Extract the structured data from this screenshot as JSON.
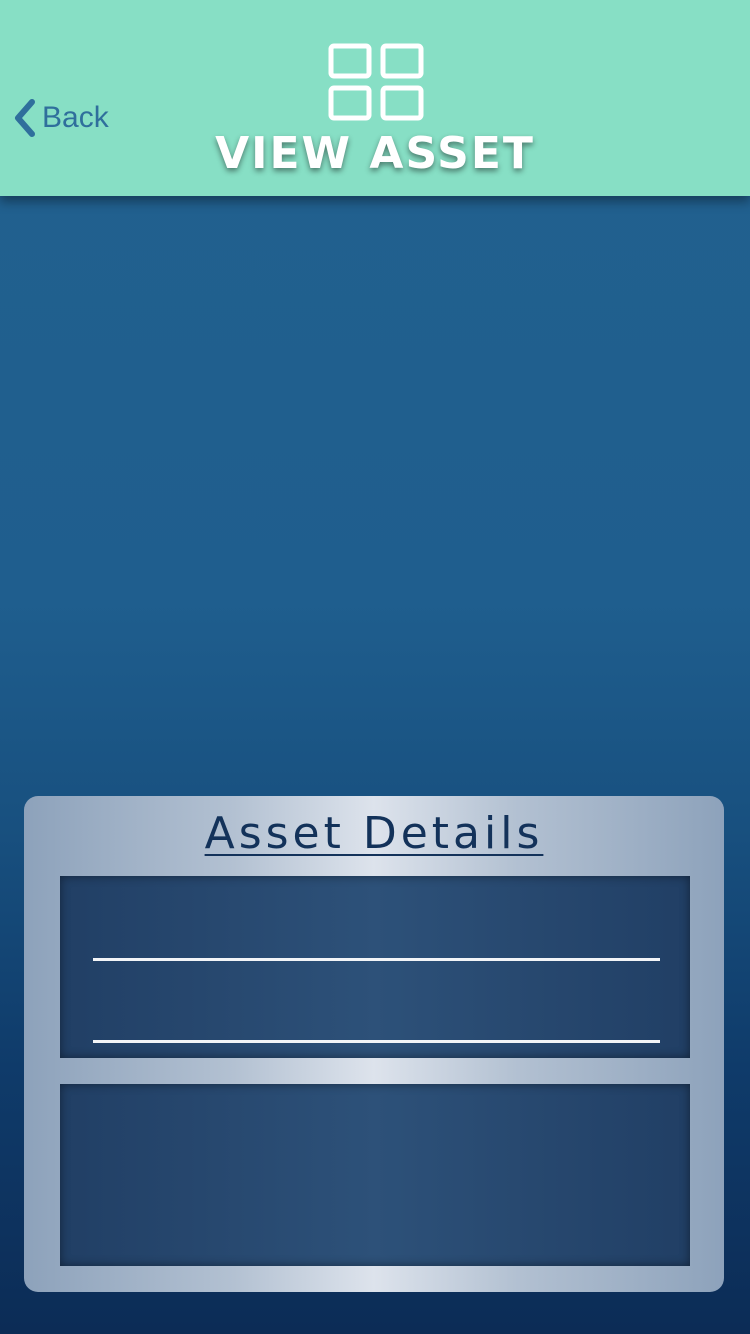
{
  "header": {
    "back_label": "Back",
    "title": "VIEW ASSET",
    "icon": "grid-icon",
    "background_color": "#87dfc5"
  },
  "details": {
    "title": "Asset Details"
  },
  "colors": {
    "title_text": "#ffffff",
    "back_text": "#2f6f9c",
    "details_title": "#13325a"
  }
}
